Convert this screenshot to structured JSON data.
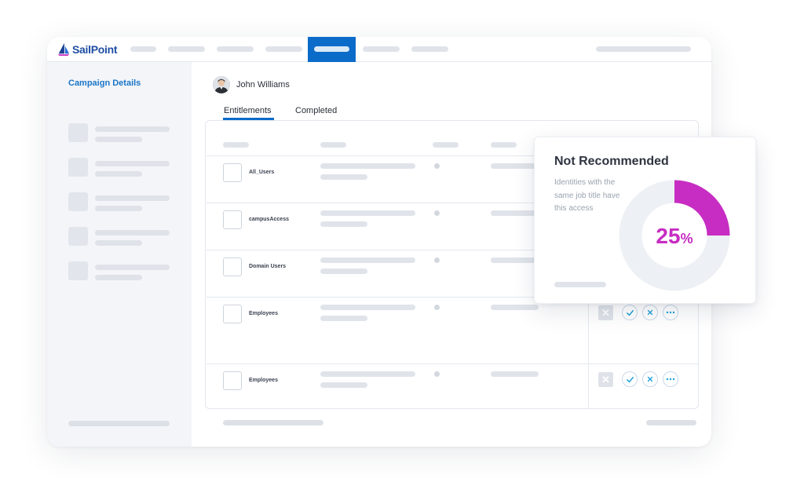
{
  "app": {
    "logo_text": "SailPoint",
    "accent_color": "#0b6bc9"
  },
  "sidebar": {
    "title": "Campaign Details"
  },
  "user": {
    "name": "John Williams"
  },
  "tabs": [
    {
      "label": "Entitlements",
      "active": true
    },
    {
      "label": "Completed",
      "active": false
    }
  ],
  "rows": [
    {
      "label": "All_Users",
      "has_actions": false
    },
    {
      "label": "campusAccess",
      "has_actions": false
    },
    {
      "label": "Domain Users",
      "has_actions": false
    },
    {
      "label": "Employees",
      "has_actions": true
    },
    {
      "label": "Employees",
      "has_actions": true
    }
  ],
  "recommendation": {
    "title": "Not Recommended",
    "description": "Identities with the same job title have this access",
    "percent_value": "25",
    "percent_sign": "%",
    "fraction": 0.25,
    "color": "#c72dc2"
  },
  "icons": [
    "x-icon",
    "check-icon",
    "close-icon",
    "more-icon"
  ]
}
